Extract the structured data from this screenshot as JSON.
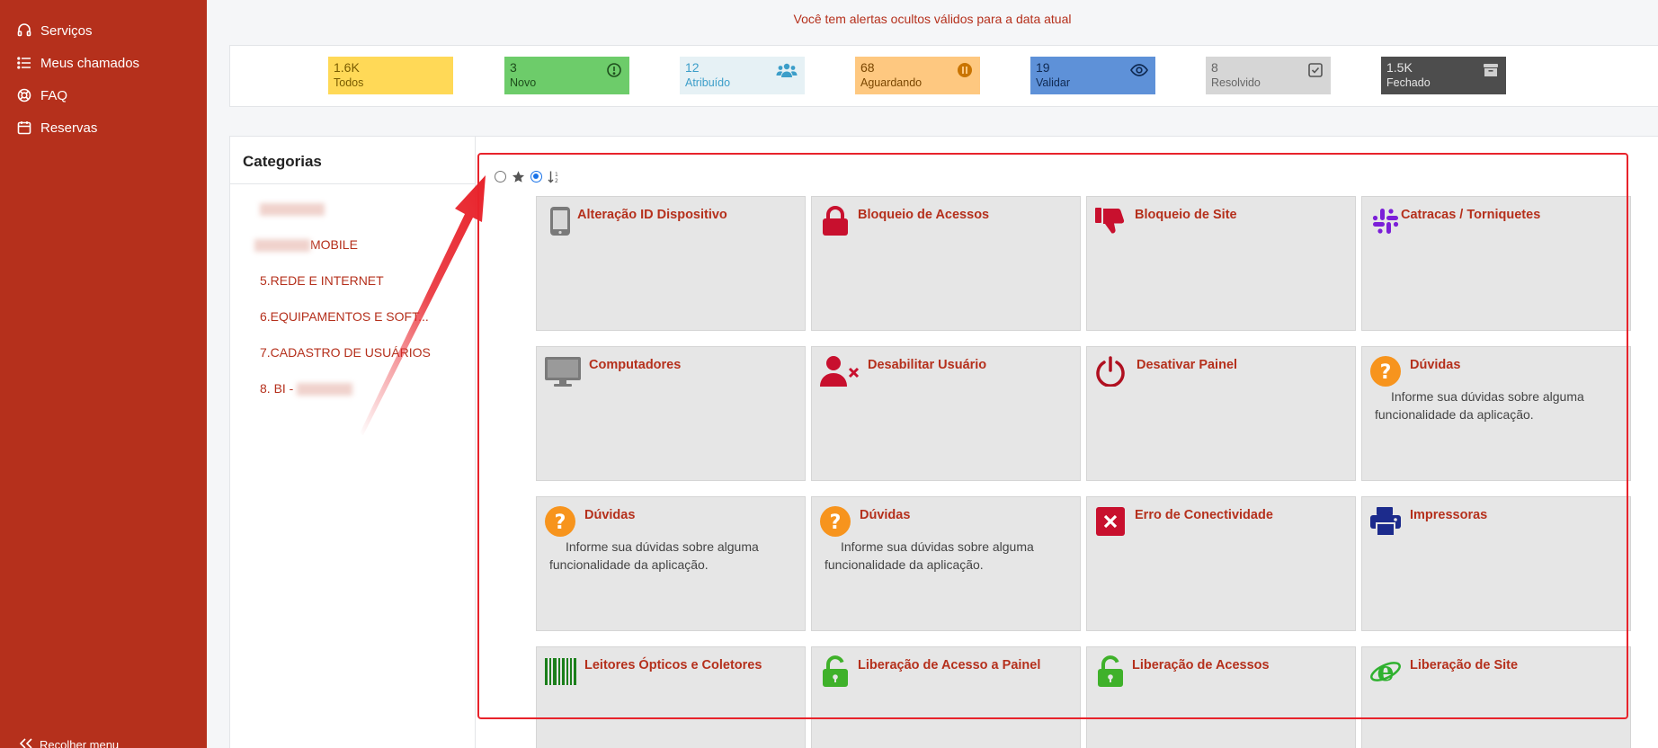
{
  "sidebar": {
    "items": [
      {
        "label": "Serviços",
        "icon": "headset-icon"
      },
      {
        "label": "Meus chamados",
        "icon": "list-icon"
      },
      {
        "label": "FAQ",
        "icon": "lifebuoy-icon"
      },
      {
        "label": "Reservas",
        "icon": "calendar-icon"
      }
    ],
    "collapse_label": "Recolher menu"
  },
  "alert": {
    "text": "Você tem alertas ocultos válidos para a data atual"
  },
  "status_tiles": [
    {
      "count": "1.6K",
      "label": "Todos",
      "color": "#ffd957",
      "icon": ""
    },
    {
      "count": "3",
      "label": "Novo",
      "color": "#6dcc6a",
      "icon": "alert-circle-icon"
    },
    {
      "count": "12",
      "label": "Atribuído",
      "color": "#e6f1f5",
      "icon": "users-icon"
    },
    {
      "count": "68",
      "label": "Aguardando",
      "color": "#fec880",
      "icon": "pause-icon"
    },
    {
      "count": "19",
      "label": "Validar",
      "color": "#5e91d8",
      "icon": "eye-icon"
    },
    {
      "count": "8",
      "label": "Resolvido",
      "color": "#d6d6d6",
      "icon": "check-square-icon"
    },
    {
      "count": "1.5K",
      "label": "Fechado",
      "color": "#4d4d4d",
      "icon": "archive-icon"
    }
  ],
  "categories": {
    "title": "Categorias",
    "items": [
      {
        "label": ""
      },
      {
        "label": "MOBILE"
      },
      {
        "label": "5.REDE E INTERNET"
      },
      {
        "label": "6.EQUIPAMENTOS E SOFT..."
      },
      {
        "label": "7.CADASTRO DE USUÁRIOS"
      },
      {
        "label": "8. BI -"
      }
    ]
  },
  "toolbar": {
    "icons": [
      "radio-unchecked",
      "star-icon",
      "radio-checked",
      "sort-icon"
    ]
  },
  "cards": [
    {
      "title": "Alteração ID Dispositivo",
      "description": "",
      "icon": "phone-icon"
    },
    {
      "title": "Bloqueio de Acessos",
      "description": "",
      "icon": "lock-icon"
    },
    {
      "title": "Bloqueio de Site",
      "description": "",
      "icon": "thumbs-down-icon"
    },
    {
      "title": "Catracas / Torniquetes",
      "description": "",
      "icon": "slack-icon"
    },
    {
      "title": "Computadores",
      "description": "",
      "icon": "monitor-icon"
    },
    {
      "title": "Desabilitar Usuário",
      "description": "",
      "icon": "user-x-icon"
    },
    {
      "title": "Desativar Painel",
      "description": "",
      "icon": "power-icon"
    },
    {
      "title": "Dúvidas",
      "description": "Informe sua dúvidas sobre alguma funcionalidade da aplicação.",
      "icon": "question-icon"
    },
    {
      "title": "Dúvidas",
      "description": "Informe sua dúvidas sobre alguma funcionalidade da aplicação.",
      "icon": "question-icon"
    },
    {
      "title": "Dúvidas",
      "description": "Informe sua dúvidas sobre alguma funcionalidade da aplicação.",
      "icon": "question-icon"
    },
    {
      "title": "Erro de Conectividade",
      "description": "",
      "icon": "x-square-icon"
    },
    {
      "title": "Impressoras",
      "description": "",
      "icon": "printer-icon"
    },
    {
      "title": "Leitores Ópticos e Coletores",
      "description": "",
      "icon": "barcode-icon"
    },
    {
      "title": "Liberação de Acesso a Painel",
      "description": "",
      "icon": "unlock-icon"
    },
    {
      "title": "Liberação de Acessos",
      "description": "",
      "icon": "unlock-icon"
    },
    {
      "title": "Liberação de Site",
      "description": "",
      "icon": "ie-icon"
    }
  ],
  "colors": {
    "brand": "#b5301c",
    "highlight": "#e8232b"
  }
}
